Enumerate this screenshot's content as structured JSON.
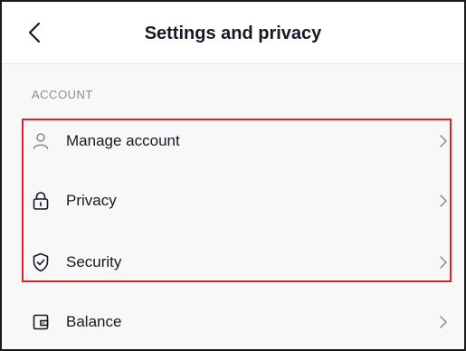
{
  "header": {
    "title": "Settings and privacy",
    "back_icon": "chevron-left-icon"
  },
  "account_section": {
    "heading": "ACCOUNT",
    "items": [
      {
        "label": "Manage account",
        "icon": "person-icon"
      },
      {
        "label": "Privacy",
        "icon": "lock-icon"
      },
      {
        "label": "Security",
        "icon": "shield-icon"
      },
      {
        "label": "Balance",
        "icon": "wallet-icon"
      }
    ]
  },
  "colors": {
    "highlight": "#e1202b",
    "text": "#161823",
    "secondary_text": "#8a8b91",
    "background": "#f8f8f8"
  }
}
